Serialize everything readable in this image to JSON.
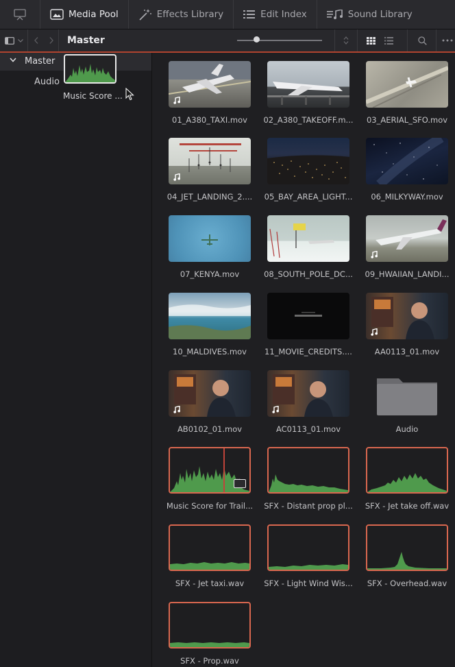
{
  "toolbar": {
    "media_pool": "Media Pool",
    "effects_library": "Effects Library",
    "edit_index": "Edit Index",
    "sound_library": "Sound Library"
  },
  "nav": {
    "breadcrumb": "Master"
  },
  "sidebar": {
    "master": "Master",
    "audio": "Audio",
    "drag_clip_name": "Music Score ..."
  },
  "clips": [
    {
      "name": "01_A380_TAXI.mov",
      "type": "video",
      "audio_icon": true
    },
    {
      "name": "02_A380_TAKEOFF.m...",
      "type": "video",
      "audio_icon": false
    },
    {
      "name": "03_AERIAL_SFO.mov",
      "type": "video",
      "audio_icon": false
    },
    {
      "name": "04_JET_LANDING_2....",
      "type": "video",
      "audio_icon": true
    },
    {
      "name": "05_BAY_AREA_LIGHT...",
      "type": "video",
      "audio_icon": false
    },
    {
      "name": "06_MILKYWAY.mov",
      "type": "video",
      "audio_icon": false
    },
    {
      "name": "07_KENYA.mov",
      "type": "video",
      "audio_icon": false
    },
    {
      "name": "08_SOUTH_POLE_DC...",
      "type": "video",
      "audio_icon": false
    },
    {
      "name": "09_HWAIIAN_LANDI...",
      "type": "video",
      "audio_icon": true
    },
    {
      "name": "10_MALDIVES.mov",
      "type": "video",
      "audio_icon": false
    },
    {
      "name": "11_MOVIE_CREDITS....",
      "type": "video",
      "audio_icon": false
    },
    {
      "name": "AA0113_01.mov",
      "type": "video",
      "audio_icon": true
    },
    {
      "name": "AB0102_01.mov",
      "type": "video",
      "audio_icon": true
    },
    {
      "name": "AC0113_01.mov",
      "type": "video",
      "audio_icon": true
    },
    {
      "name": "Audio",
      "type": "folder"
    },
    {
      "name": "Music Score for Trail...",
      "type": "audio"
    },
    {
      "name": "SFX - Distant prop pl...",
      "type": "audio"
    },
    {
      "name": "SFX - Jet take off.wav",
      "type": "audio"
    },
    {
      "name": "SFX - Jet taxi.wav",
      "type": "audio"
    },
    {
      "name": "SFX - Light Wind Wis...",
      "type": "audio"
    },
    {
      "name": "SFX - Overhead.wav",
      "type": "audio"
    },
    {
      "name": "SFX - Prop.wav",
      "type": "audio"
    }
  ],
  "colors": {
    "accent": "#d9674f",
    "waveform": "#4f9a4c"
  }
}
